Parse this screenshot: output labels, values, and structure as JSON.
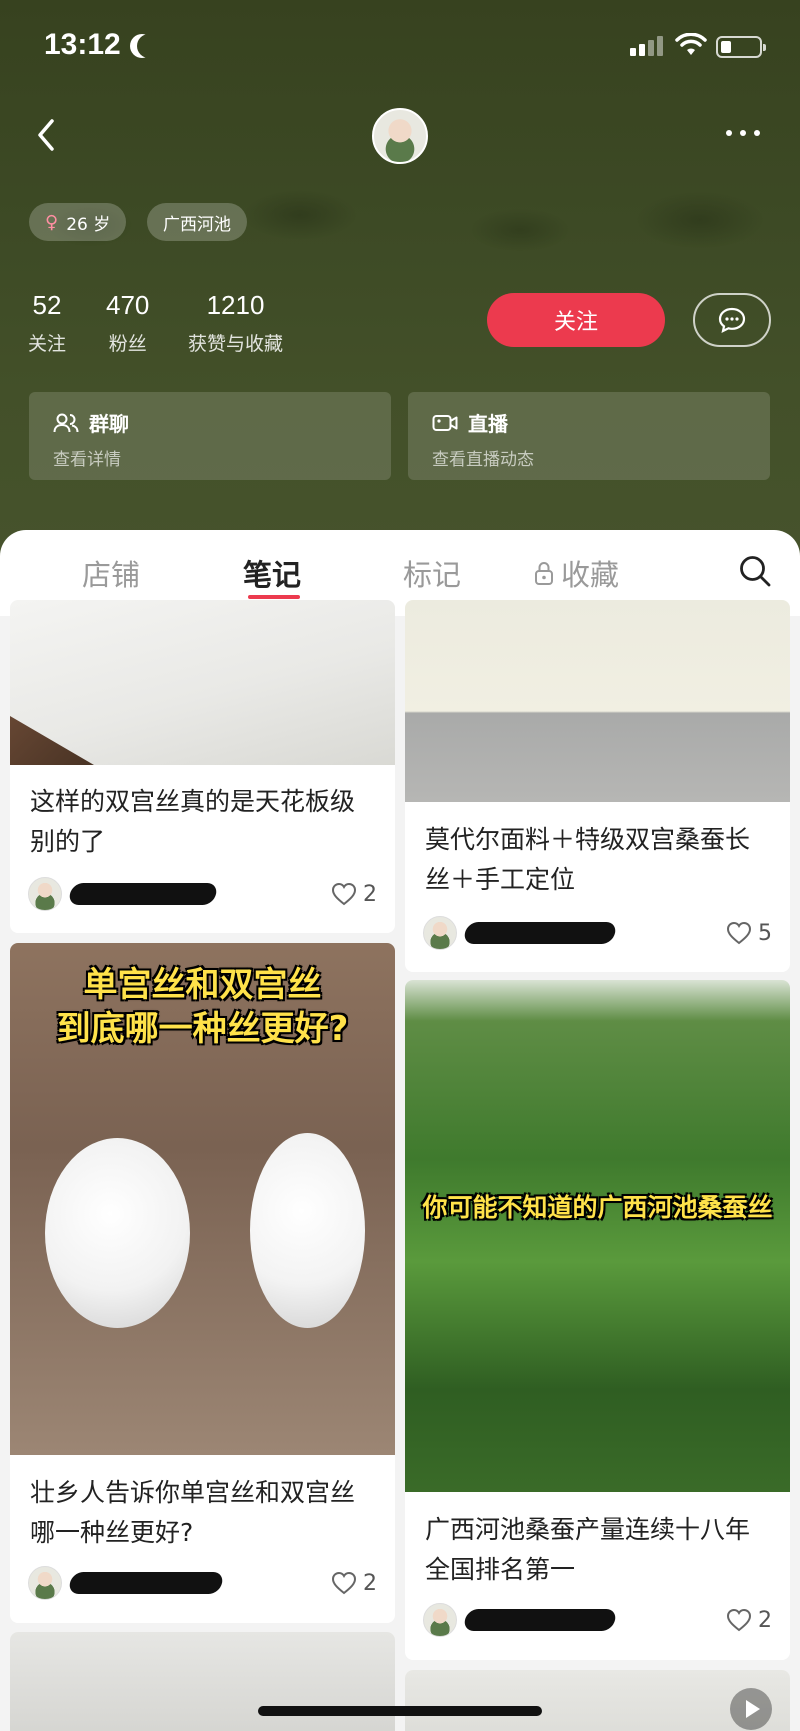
{
  "status_bar": {
    "time": "13:12"
  },
  "profile": {
    "tags": {
      "age": "26 岁",
      "location": "广西河池"
    },
    "stats": [
      {
        "num": "52",
        "label": "关注"
      },
      {
        "num": "470",
        "label": "粉丝"
      },
      {
        "num": "1210",
        "label": "获赞与收藏"
      }
    ],
    "follow_label": "关注",
    "group_chat": {
      "title": "群聊",
      "subtitle": "查看详情"
    },
    "live": {
      "title": "直播",
      "subtitle": "查看直播动态"
    }
  },
  "tabs": [
    "店铺",
    "笔记",
    "标记",
    "收藏"
  ],
  "active_tab": "笔记",
  "notes": {
    "left": [
      {
        "title": "这样的双宫丝真的是天花板级别的了",
        "likes": "2"
      },
      {
        "title": "壮乡人告诉你单宫丝和双宫丝哪一种丝更好?",
        "likes": "2",
        "image_text": [
          "单宫丝和双宫丝",
          "到底哪一种丝更好?"
        ]
      },
      {
        "title": ""
      }
    ],
    "right": [
      {
        "title": "莫代尔面料＋特级双宫桑蚕长丝＋手工定位",
        "likes": "5"
      },
      {
        "title": "广西河池桑蚕产量连续十八年全国排名第一",
        "likes": "2",
        "image_text": "你可能不知道的广西河池桑蚕丝"
      },
      {
        "title": ""
      }
    ]
  },
  "colors": {
    "accent": "#ec3a4e",
    "header_bg": "#3d4a25"
  }
}
